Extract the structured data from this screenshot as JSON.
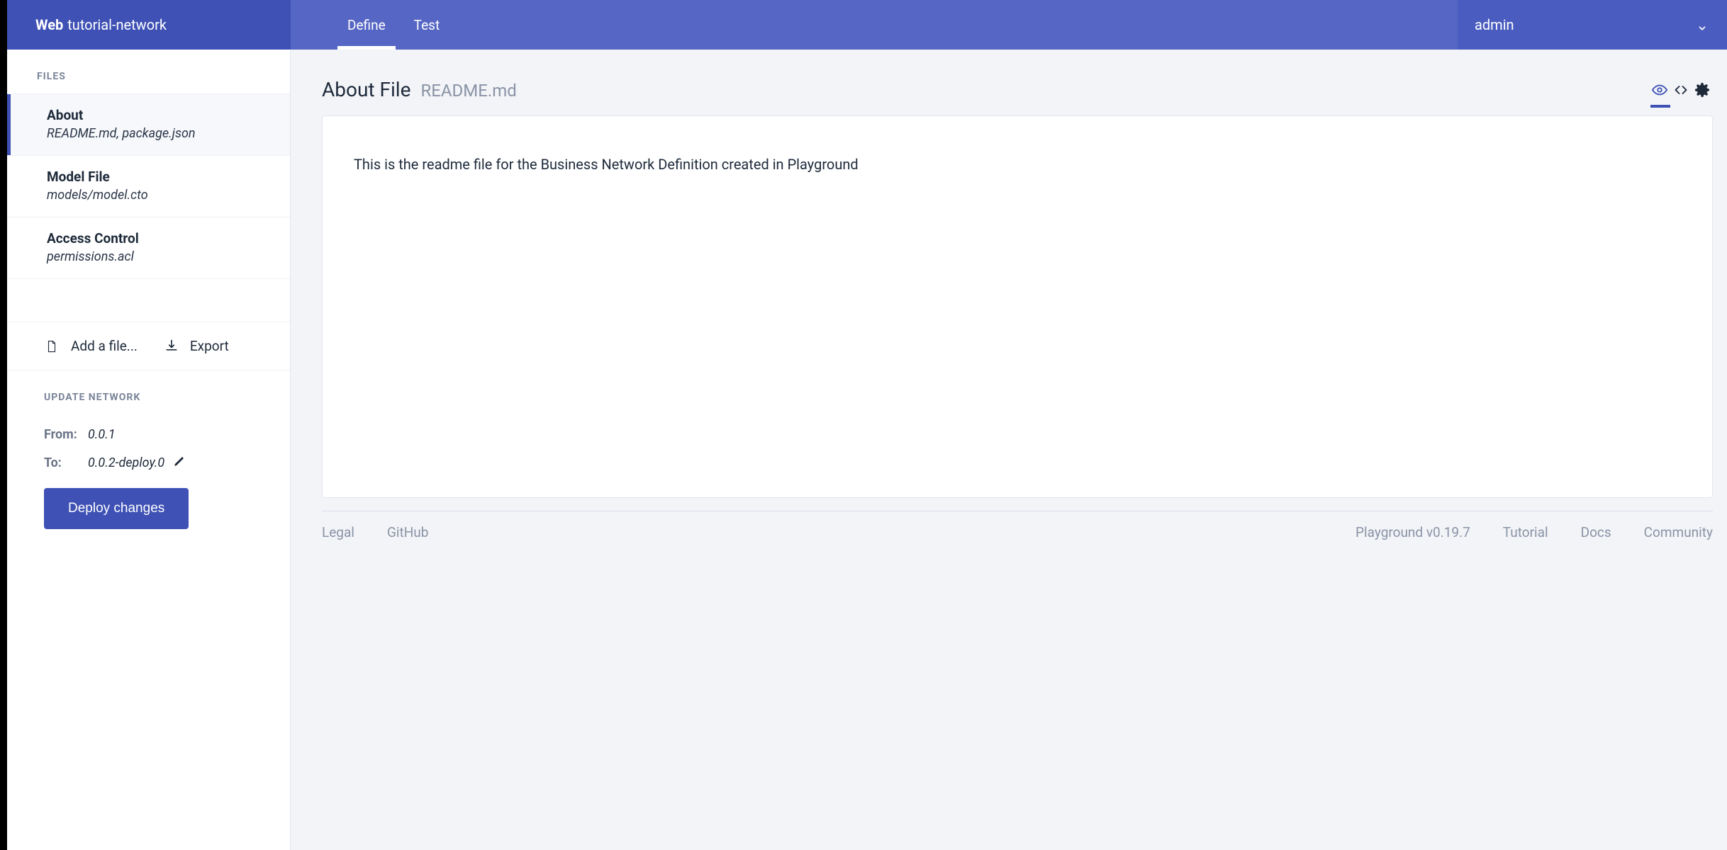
{
  "header": {
    "brand_prefix": "Web",
    "brand_name": "tutorial-network",
    "tabs": [
      {
        "label": "Define",
        "active": true
      },
      {
        "label": "Test",
        "active": false
      }
    ],
    "user": "admin"
  },
  "sidebar": {
    "files_label": "FILES",
    "items": [
      {
        "title": "About",
        "subtitle": "README.md, package.json",
        "active": true
      },
      {
        "title": "Model File",
        "subtitle": "models/model.cto",
        "active": false
      },
      {
        "title": "Access Control",
        "subtitle": "permissions.acl",
        "active": false
      }
    ],
    "add_file_label": "Add a file...",
    "export_label": "Export",
    "update_label": "UPDATE NETWORK",
    "from_label": "From:",
    "from_value": "0.0.1",
    "to_label": "To:",
    "to_value": "0.0.2-deploy.0",
    "deploy_label": "Deploy changes"
  },
  "main": {
    "title": "About File",
    "filename": "README.md",
    "readme_text": "This is the readme file for the Business Network Definition created in Playground"
  },
  "footer": {
    "left": [
      "Legal",
      "GitHub"
    ],
    "version": "Playground v0.19.7",
    "right": [
      "Tutorial",
      "Docs",
      "Community"
    ]
  }
}
